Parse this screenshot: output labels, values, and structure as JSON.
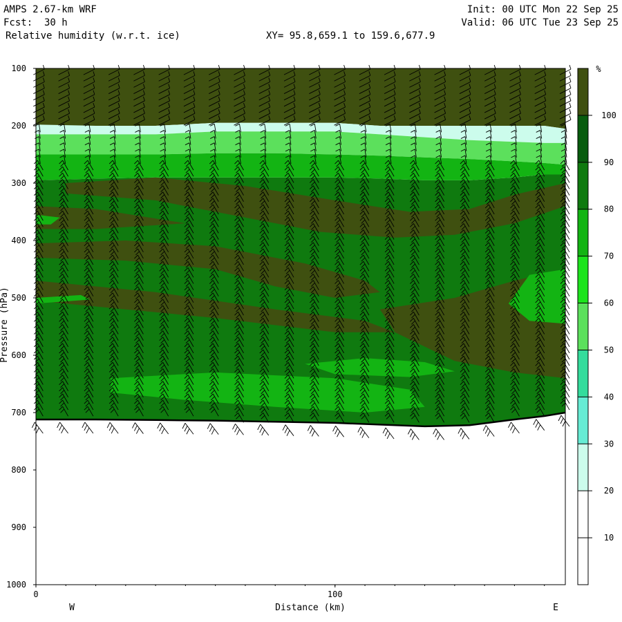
{
  "header": {
    "model": "AMPS 2.67-km WRF",
    "fcst_label": "Fcst:",
    "fcst_value": "30 h",
    "field": "Relative humidity (w.r.t. ice)",
    "xy": "XY=  95.8,659.1 to 159.6,677.9",
    "init": "Init: 00 UTC Mon 22 Sep 25",
    "valid": "Valid: 06 UTC Tue 23 Sep 25"
  },
  "chart_data": {
    "type": "cross-section",
    "xlabel": "Distance (km)",
    "ylabel": "Pressure (hPa)",
    "x_ticks": [
      "0",
      "100"
    ],
    "x_tick_values": [
      0,
      100
    ],
    "x_range": [
      0,
      177
    ],
    "x_end_labels": [
      "W",
      "E"
    ],
    "y_ticks": [
      "100",
      "200",
      "300",
      "400",
      "500",
      "600",
      "700",
      "800",
      "900",
      "1000"
    ],
    "y_tick_values": [
      100,
      200,
      300,
      400,
      500,
      600,
      700,
      800,
      900,
      1000
    ],
    "y_range": [
      100,
      1000
    ],
    "colorbar": {
      "unit_label": "%",
      "ticks": [
        "10",
        "20",
        "30",
        "40",
        "50",
        "60",
        "70",
        "80",
        "90",
        "100"
      ],
      "tick_values": [
        10,
        20,
        30,
        40,
        50,
        60,
        70,
        80,
        90,
        100
      ],
      "levels": [
        0,
        10,
        20,
        30,
        40,
        50,
        60,
        70,
        80,
        90,
        100,
        110
      ],
      "colors": [
        "#ffffff",
        "#ffffff",
        "#ffffff",
        "#ccfcec",
        "#66ecd4",
        "#34dc9c",
        "#5ce05c",
        "#1ce41c",
        "#13b413",
        "#0f7a0f",
        "#085c0e",
        "#3f5010"
      ]
    },
    "terrain_surface_pressure": {
      "x": [
        0,
        20,
        40,
        60,
        80,
        100,
        115,
        130,
        145,
        160,
        170,
        177
      ],
      "p": [
        712,
        712,
        713,
        714,
        716,
        718,
        721,
        724,
        722,
        712,
        706,
        700
      ]
    },
    "rh_bands": [
      {
        "level": "100+",
        "color": "#3f5010",
        "p_top": [
          100,
          100,
          100,
          100,
          100,
          100,
          100,
          100,
          100,
          100,
          100,
          100
        ],
        "p_bottom": [
          200,
          200,
          200,
          195,
          195,
          195,
          200,
          200,
          200,
          200,
          200,
          205
        ]
      },
      {
        "level": "30-40",
        "color": "#ccfcec",
        "p_top": [
          198,
          200,
          200,
          195,
          195,
          195,
          200,
          200,
          200,
          200,
          200,
          205
        ],
        "p_bottom": [
          215,
          215,
          215,
          210,
          210,
          210,
          215,
          220,
          225,
          228,
          230,
          230
        ]
      },
      {
        "level": "60-80",
        "color": "#5ce05c",
        "p_top": [
          215,
          215,
          215,
          210,
          210,
          210,
          215,
          220,
          225,
          228,
          230,
          230
        ],
        "p_bottom": [
          250,
          250,
          250,
          248,
          248,
          250,
          252,
          255,
          258,
          262,
          265,
          268
        ]
      },
      {
        "level": "80-90",
        "color": "#13b413",
        "p_top": [
          250,
          250,
          250,
          248,
          248,
          250,
          252,
          255,
          258,
          262,
          265,
          268
        ],
        "p_bottom": [
          295,
          292,
          290,
          290,
          290,
          290,
          292,
          295,
          295,
          290,
          285,
          285
        ]
      }
    ]
  }
}
